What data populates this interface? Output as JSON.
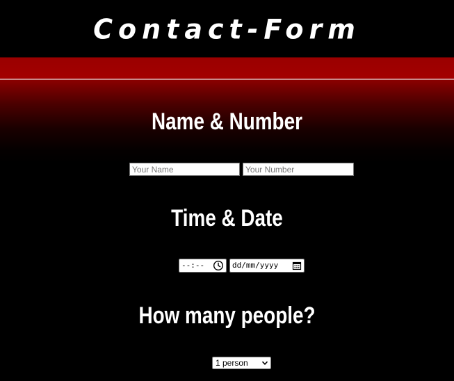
{
  "header": {
    "title": "Contact-Form"
  },
  "sections": {
    "name_number": {
      "heading": "Name & Number",
      "name_placeholder": "Your Name",
      "number_placeholder": "Your Number"
    },
    "time_date": {
      "heading": "Time & Date",
      "time_value": "--:--",
      "date_value": "dd/mm/yyyy",
      "time_icon": "clock-icon",
      "date_icon": "calendar-icon"
    },
    "people": {
      "heading": "How many people?",
      "selected": "1 person",
      "dropdown_icon": "chevron-down-icon"
    }
  },
  "colors": {
    "background": "#000000",
    "accent_red": "#a30000",
    "text": "#ffffff",
    "divider": "#c98a8a"
  }
}
